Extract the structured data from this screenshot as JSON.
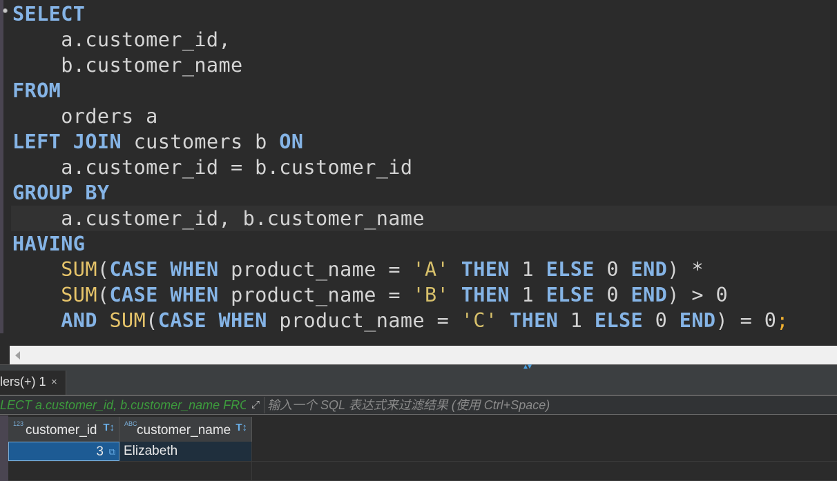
{
  "editor": {
    "lines": [
      [
        {
          "t": "SELECT",
          "c": "kw"
        }
      ],
      [
        {
          "t": "    a.customer_id,",
          "c": "id"
        }
      ],
      [
        {
          "t": "    b.customer_name",
          "c": "id"
        }
      ],
      [
        {
          "t": "FROM",
          "c": "kw"
        }
      ],
      [
        {
          "t": "    orders a",
          "c": "id"
        }
      ],
      [
        {
          "t": "LEFT JOIN",
          "c": "kw"
        },
        {
          "t": " customers b ",
          "c": "id"
        },
        {
          "t": "ON",
          "c": "kw"
        }
      ],
      [
        {
          "t": "    a.customer_id = b.customer_id",
          "c": "id"
        }
      ],
      [
        {
          "t": "GROUP BY",
          "c": "kw"
        }
      ],
      [
        {
          "t": "    a.customer_id, b.customer_name",
          "c": "id"
        }
      ],
      [
        {
          "t": "HAVING",
          "c": "kw"
        }
      ],
      [
        {
          "t": "    ",
          "c": "id"
        },
        {
          "t": "SUM",
          "c": "fn"
        },
        {
          "t": "(",
          "c": "op"
        },
        {
          "t": "CASE WHEN",
          "c": "kw"
        },
        {
          "t": " product_name = ",
          "c": "id"
        },
        {
          "t": "'A'",
          "c": "str"
        },
        {
          "t": " ",
          "c": "id"
        },
        {
          "t": "THEN",
          "c": "kw"
        },
        {
          "t": " 1 ",
          "c": "num"
        },
        {
          "t": "ELSE",
          "c": "kw"
        },
        {
          "t": " 0 ",
          "c": "num"
        },
        {
          "t": "END",
          "c": "kw"
        },
        {
          "t": ") *",
          "c": "op"
        }
      ],
      [
        {
          "t": "    ",
          "c": "id"
        },
        {
          "t": "SUM",
          "c": "fn"
        },
        {
          "t": "(",
          "c": "op"
        },
        {
          "t": "CASE WHEN",
          "c": "kw"
        },
        {
          "t": " product_name = ",
          "c": "id"
        },
        {
          "t": "'B'",
          "c": "str"
        },
        {
          "t": " ",
          "c": "id"
        },
        {
          "t": "THEN",
          "c": "kw"
        },
        {
          "t": " 1 ",
          "c": "num"
        },
        {
          "t": "ELSE",
          "c": "kw"
        },
        {
          "t": " 0 ",
          "c": "num"
        },
        {
          "t": "END",
          "c": "kw"
        },
        {
          "t": ") > 0",
          "c": "op"
        }
      ],
      [
        {
          "t": "    ",
          "c": "id"
        },
        {
          "t": "AND",
          "c": "kw"
        },
        {
          "t": " ",
          "c": "id"
        },
        {
          "t": "SUM",
          "c": "fn"
        },
        {
          "t": "(",
          "c": "op"
        },
        {
          "t": "CASE WHEN",
          "c": "kw"
        },
        {
          "t": " product_name = ",
          "c": "id"
        },
        {
          "t": "'C'",
          "c": "str"
        },
        {
          "t": " ",
          "c": "id"
        },
        {
          "t": "THEN",
          "c": "kw"
        },
        {
          "t": " 1 ",
          "c": "num"
        },
        {
          "t": "ELSE",
          "c": "kw"
        },
        {
          "t": " 0 ",
          "c": "num"
        },
        {
          "t": "END",
          "c": "kw"
        },
        {
          "t": ") = 0",
          "c": "op"
        },
        {
          "t": ";",
          "c": "semi"
        }
      ]
    ],
    "current_line": 8
  },
  "results": {
    "tab_label": "lers(+) 1",
    "tab_close": "×",
    "query_preview": "LECT a.customer_id, b.customer_name FRO",
    "filter_placeholder": "输入一个 SQL 表达式来过滤结果 (使用 Ctrl+Space)",
    "columns": [
      {
        "name": "customer_id",
        "type_badge": "123"
      },
      {
        "name": "customer_name",
        "type_badge": "ABC"
      }
    ],
    "rows": [
      {
        "customer_id": "3",
        "customer_name": "Elizabeth"
      }
    ]
  },
  "colors": {
    "keyword": "#85b4e6",
    "function": "#e6c46a",
    "string": "#d7c06b",
    "selected_cell": "#1d5b94"
  }
}
